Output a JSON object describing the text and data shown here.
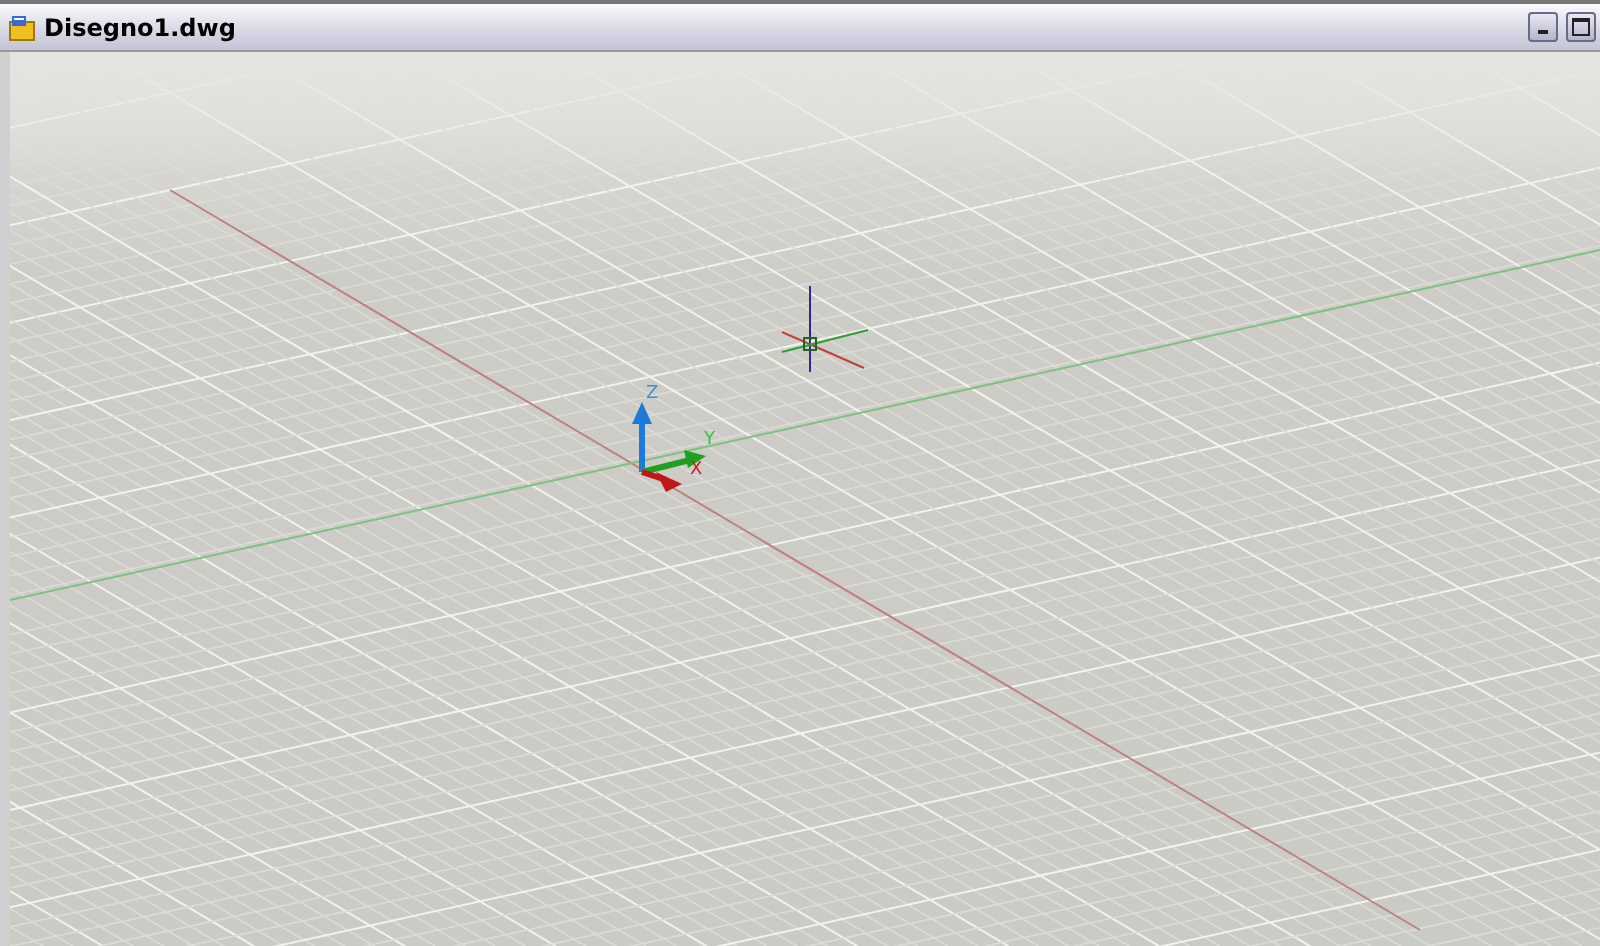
{
  "window": {
    "title": "Disegno1.dwg",
    "buttons": [
      {
        "kind": "minimize"
      },
      {
        "kind": "maximize"
      }
    ]
  },
  "viewport": {
    "ucs_labels": [
      "Z",
      "Y",
      "X"
    ]
  }
}
